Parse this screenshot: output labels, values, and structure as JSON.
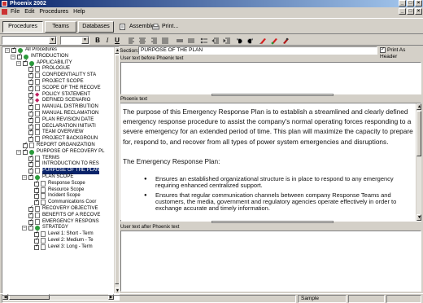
{
  "window": {
    "title": "Phoenix 2002",
    "caption_buttons": [
      "_",
      "□",
      "×"
    ],
    "mdi_buttons": [
      "_",
      "□",
      "×"
    ]
  },
  "menu": [
    "File",
    "Edit",
    "Procedures",
    "Help"
  ],
  "toolbar": {
    "tabs": [
      "Procedures",
      "Teams",
      "Databases"
    ],
    "assemble_label": "Assemble...",
    "print_label": "Print..."
  },
  "format": {
    "bold": "B",
    "italic": "I",
    "underline": "U"
  },
  "tree": {
    "nodes": [
      {
        "label": "All Procedures",
        "indent": 0,
        "expander": "−",
        "icon": "globe"
      },
      {
        "label": "INTRODUCTION",
        "indent": 1,
        "expander": "−",
        "icon": "globe"
      },
      {
        "label": "APPLICABILITY",
        "indent": 2,
        "expander": "−",
        "icon": "globe"
      },
      {
        "label": "PROLOGUE",
        "indent": 3,
        "icon": "doc"
      },
      {
        "label": "CONFIDENTIALITY STA",
        "indent": 3,
        "icon": "doc"
      },
      {
        "label": "PROJECT SCOPE",
        "indent": 3,
        "icon": "doc"
      },
      {
        "label": "SCOPE OF THE RECOVE",
        "indent": 3,
        "icon": "doc"
      },
      {
        "label": "POLICY STATEMENT",
        "indent": 3,
        "icon": "red"
      },
      {
        "label": "DEFINED SCENARIO",
        "indent": 3,
        "icon": "red"
      },
      {
        "label": "MANUAL DISTRIBUTION",
        "indent": 3,
        "icon": "doc"
      },
      {
        "label": "MANUAL RECLAMATION",
        "indent": 3,
        "icon": "doc"
      },
      {
        "label": "PLAN REVISION DATE",
        "indent": 3,
        "icon": "doc"
      },
      {
        "label": "DECLARATION INITIATI",
        "indent": 3,
        "icon": "doc"
      },
      {
        "label": "TEAM OVERVIEW",
        "indent": 3,
        "icon": "doc"
      },
      {
        "label": "PROJECT BACKGROUN",
        "indent": 3,
        "icon": "doc"
      },
      {
        "label": "REPORT ORGANIZATION",
        "indent": 2,
        "icon": "doc"
      },
      {
        "label": "PURPOSE OF RECOVERY PL",
        "indent": 2,
        "expander": "−",
        "icon": "globe"
      },
      {
        "label": "TERMS",
        "indent": 3,
        "icon": "doc"
      },
      {
        "label": "INTRODUCTION TO RES",
        "indent": 3,
        "icon": "doc"
      },
      {
        "label": "PURPOSE OF THE PLAN",
        "indent": 3,
        "icon": "doc",
        "selected": true
      },
      {
        "label": "PLAN SCOPE",
        "indent": 3,
        "expander": "−",
        "icon": "globe"
      },
      {
        "label": "Response Scope",
        "indent": 4,
        "icon": "doc"
      },
      {
        "label": "Resource Scope",
        "indent": 4,
        "icon": "doc"
      },
      {
        "label": "Incident Scope",
        "indent": 4,
        "icon": "doc"
      },
      {
        "label": "Communications Coor",
        "indent": 4,
        "icon": "doc"
      },
      {
        "label": "RECOVERY OBJECTIVE",
        "indent": 3,
        "icon": "doc"
      },
      {
        "label": "BENEFITS OF A RECOVE",
        "indent": 3,
        "icon": "doc"
      },
      {
        "label": "EMERGENCY RESPONS",
        "indent": 3,
        "icon": "doc"
      },
      {
        "label": "STRATEGY",
        "indent": 3,
        "expander": "−",
        "icon": "globe"
      },
      {
        "label": "Level 1: Short - Term",
        "indent": 4,
        "icon": "doc"
      },
      {
        "label": "Level 2: Medium - Te",
        "indent": 4,
        "icon": "doc"
      },
      {
        "label": "Level 3: Long - Term",
        "indent": 4,
        "icon": "doc"
      }
    ]
  },
  "section": {
    "label": "Section:",
    "value": "PURPOSE OF THE PLAN",
    "print_as_header_label": "Print As Header"
  },
  "panes": {
    "before_label": "User text before Phoenix text",
    "phoenix_label": "Phoenix text",
    "after_label": "User text after Phoenix text"
  },
  "document": {
    "paragraph1": "The purpose of this Emergency Response Plan is to establish a streamlined and clearly defined emergency response procedure to assist the company's normal operating forces responding to a severe emergency for an extended period of time.  This plan will maximize the capacity to prepare for, respond to, and recover from all types of power system emergencies and disruptions.",
    "paragraph2": "The Emergency Response Plan:",
    "bullets": [
      "Ensures an established organizational structure is in place to respond to any emergency requiring enhanced centralized support.",
      "Ensures that regular communication channels between company Response Teams and customers, the media, government and regulatory agencies operate effectively in order to exchange accurate and timely information."
    ]
  },
  "status": {
    "mode": "Sample"
  }
}
